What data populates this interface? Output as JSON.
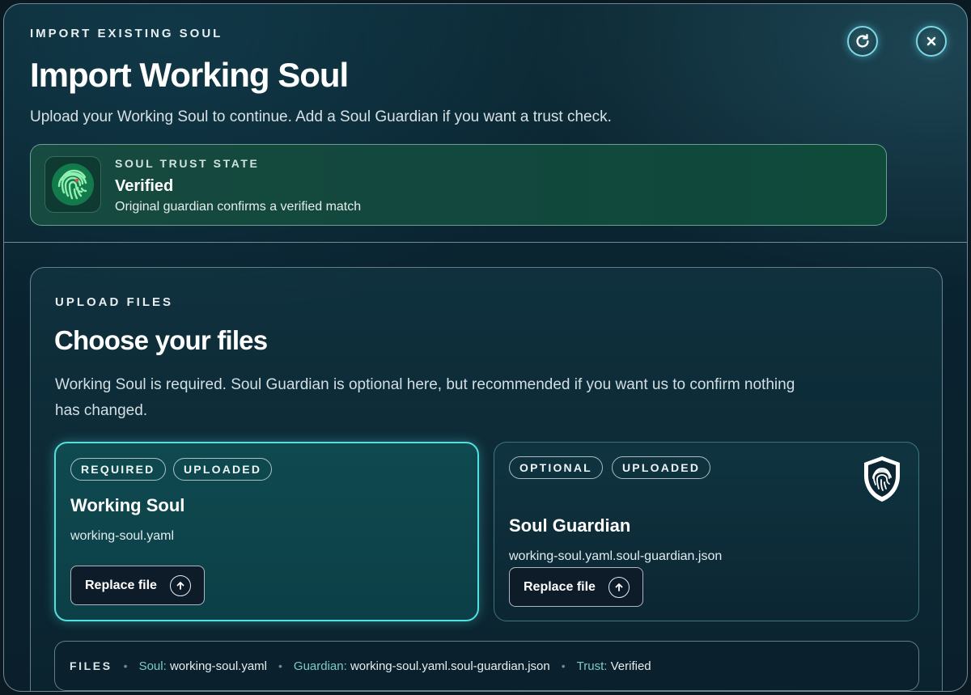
{
  "header": {
    "eyebrow": "IMPORT EXISTING SOUL",
    "title": "Import Working Soul",
    "subtitle": "Upload your Working Soul to continue. Add a Soul Guardian if you want a trust check.",
    "refresh_icon": "refresh-icon",
    "close_icon": "close-icon"
  },
  "trust": {
    "eyebrow": "SOUL TRUST STATE",
    "state": "Verified",
    "description": "Original guardian confirms a verified match",
    "icon": "fingerprint-icon",
    "accent": "#1f9f6a"
  },
  "upload": {
    "eyebrow": "UPLOAD FILES",
    "title": "Choose your files",
    "description": "Working Soul is required. Soul Guardian is optional here, but recommended if you want us to confirm nothing has changed.",
    "cards": [
      {
        "badges": [
          "REQUIRED",
          "UPLOADED"
        ],
        "title": "Working Soul",
        "filename": "working-soul.yaml",
        "button_label": "Replace file",
        "accent": "#52e0e0"
      },
      {
        "badges": [
          "OPTIONAL",
          "UPLOADED"
        ],
        "title": "Soul Guardian",
        "filename": "working-soul.yaml.soul-guardian.json",
        "button_label": "Replace file",
        "icon": "shield-fingerprint-icon"
      }
    ]
  },
  "files_bar": {
    "label": "FILES",
    "soul_key": "Soul:",
    "soul_value": "working-soul.yaml",
    "guardian_key": "Guardian:",
    "guardian_value": "working-soul.yaml.soul-guardian.json",
    "trust_key": "Trust:",
    "trust_value": "Verified"
  }
}
